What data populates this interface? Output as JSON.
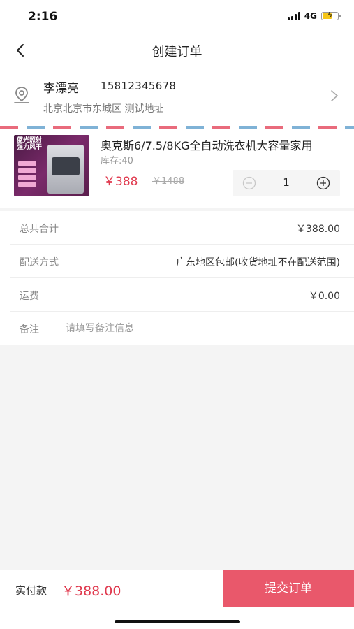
{
  "status_bar": {
    "time": "2:16",
    "network": "4G"
  },
  "nav": {
    "title": "创建订单",
    "back_icon": "chevron-left-icon"
  },
  "address": {
    "name": "李漂亮",
    "phone": "15812345678",
    "detail": "北京北京市东城区 测试地址",
    "icon": "location-pin-icon"
  },
  "product": {
    "title": "奥克斯6/7.5/8KG全自动洗衣机大容量家用",
    "stock": "库存:40",
    "price": "￥388",
    "original_price": "￥1488",
    "image_banner": "蓝光照射 强力风干",
    "quantity": "1"
  },
  "order_info": {
    "total_label": "总共合计",
    "total_value": "￥388.00",
    "delivery_label": "配送方式",
    "delivery_value": "广东地区包邮(收货地址不在配送范围)",
    "shipping_label": "运费",
    "shipping_value": "￥0.00",
    "note_label": "备注",
    "note_placeholder": "请填写备注信息",
    "note_value": ""
  },
  "footer": {
    "pay_label": "实付款",
    "pay_amount": "￥388.00",
    "submit_label": "提交订单"
  },
  "colors": {
    "accent": "#e9586b",
    "price": "#e0394e",
    "background": "#f4f4f4"
  }
}
